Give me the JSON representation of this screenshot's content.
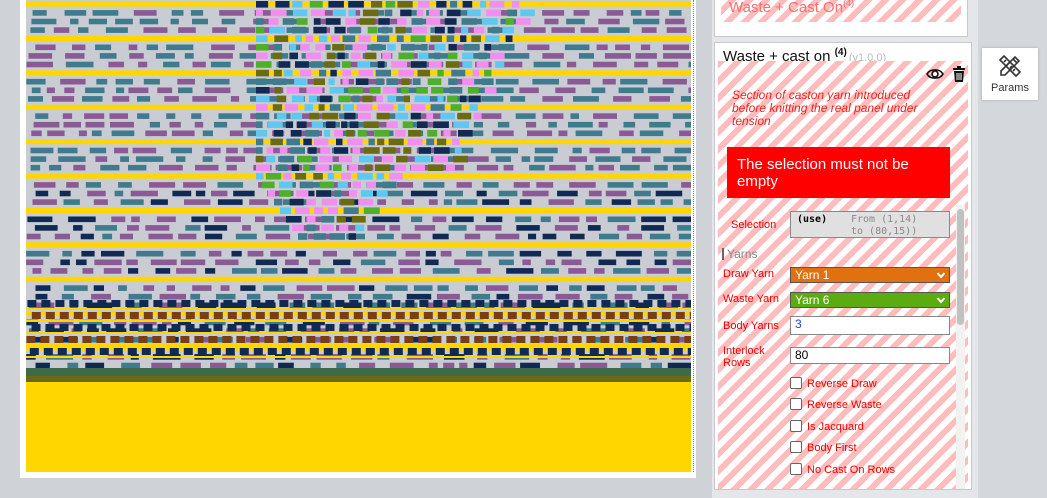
{
  "canvas": {
    "background": "#c9ccd3",
    "palette": {
      "yellow": "#ffd600",
      "purple": "#8a5a94",
      "teal": "#3f7b8c",
      "navy": "#102a54",
      "pink": "#f28ef0",
      "olive": "#6b6b12",
      "green": "#4fae2a",
      "sky": "#5ec8f0",
      "brown": "#7a3e16",
      "darkgreen": "#3d6b4a"
    }
  },
  "previous_node": {
    "title": "Waste + Cast On",
    "badge": "(4)"
  },
  "node": {
    "title": "Waste + cast on",
    "badge": "(4)",
    "version": "(v1.0.0)",
    "description": "Section of caston yarn introduced before knitting the real panel under tension",
    "error": "The selection must not be empty",
    "selection": {
      "label": "Selection",
      "mode": "(use)",
      "range": "From (1,14)\nto (80,15))"
    },
    "yarns_section": "Yarns",
    "draw_yarn": {
      "label": "Draw Yarn",
      "value": "Yarn 1",
      "color": "#e07010"
    },
    "waste_yarn": {
      "label": "Waste Yarn",
      "value": "Yarn 6",
      "color": "#5aac10"
    },
    "body_yarns": {
      "label": "Body Yarns",
      "value": "3"
    },
    "interlock_rows": {
      "label": "Interlock Rows",
      "value": "80"
    },
    "checkboxes": [
      {
        "label": "Reverse Draw",
        "checked": false
      },
      {
        "label": "Reverse Waste",
        "checked": false
      },
      {
        "label": "Is Jacquard",
        "checked": false
      },
      {
        "label": "Body First",
        "checked": false
      },
      {
        "label": "No Cast On Rows",
        "checked": false
      }
    ]
  },
  "params_button": {
    "label": "Params",
    "icon": "pencil-ruler-icon"
  },
  "icons": {
    "visibility": "eye-icon",
    "delete": "trash-icon"
  }
}
